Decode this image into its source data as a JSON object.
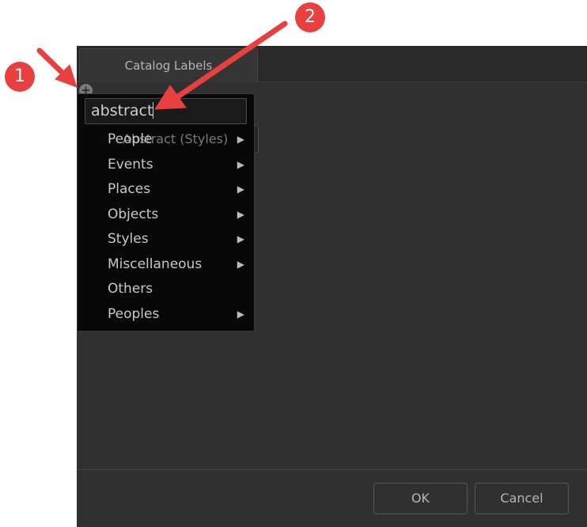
{
  "dialog": {
    "tab_label": "Catalog Labels",
    "existing_label": "Abstract (Styles)",
    "ok_label": "OK",
    "cancel_label": "Cancel"
  },
  "menu": {
    "search_value": "abstract",
    "items": [
      {
        "label": "People",
        "submenu": true
      },
      {
        "label": "Events",
        "submenu": true
      },
      {
        "label": "Places",
        "submenu": true
      },
      {
        "label": "Objects",
        "submenu": true
      },
      {
        "label": "Styles",
        "submenu": true
      },
      {
        "label": "Miscellaneous",
        "submenu": true
      },
      {
        "label": "Others",
        "submenu": false
      },
      {
        "label": "Peoples",
        "submenu": true
      }
    ],
    "submenu_glyph": "▶"
  },
  "annotations": {
    "badge1": "1",
    "badge2": "2",
    "color": "#e8403f"
  },
  "icons": {
    "add": "+"
  }
}
